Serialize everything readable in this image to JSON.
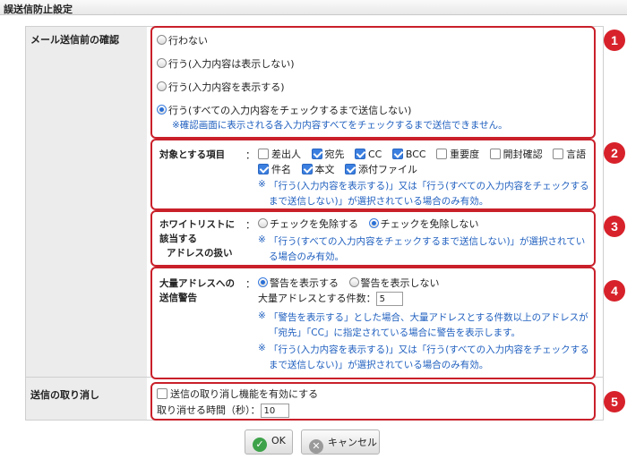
{
  "title": "誤送信防止設定",
  "rows": {
    "confirm_label": "メール送信前の確認",
    "cancel_label": "送信の取り消し"
  },
  "confirm": {
    "options": [
      "行わない",
      "行う(入力内容は表示しない)",
      "行う(入力内容を表示する)",
      "行う(すべての入力内容をチェックするまで送信しない)"
    ],
    "selected_index": 3,
    "note": "※確認画面に表示される各入力内容すべてをチェックするまで送信できません。"
  },
  "targets": {
    "label": "対象とする項目",
    "colon": "：",
    "items": [
      {
        "label": "差出人",
        "checked": false
      },
      {
        "label": "宛先",
        "checked": true
      },
      {
        "label": "CC",
        "checked": true
      },
      {
        "label": "BCC",
        "checked": true
      },
      {
        "label": "重要度",
        "checked": false
      },
      {
        "label": "開封確認",
        "checked": false
      },
      {
        "label": "言語",
        "checked": false
      },
      {
        "label": "件名",
        "checked": true
      },
      {
        "label": "本文",
        "checked": true
      },
      {
        "label": "添付ファイル",
        "checked": true
      }
    ],
    "note_mark": "※",
    "note_line1": "「行う(入力内容を表示する)」又は「行う(すべての入力内容をチェックする",
    "note_line2": "まで送信しない)」が選択されている場合のみ有効。"
  },
  "whitelist": {
    "label_line1": "ホワイトリストに",
    "label_line2": "該当する",
    "label_line3": "アドレスの扱い",
    "colon": "：",
    "options": [
      "チェックを免除する",
      "チェックを免除しない"
    ],
    "selected_index": 1,
    "note_mark": "※",
    "note_line1": "「行う(すべての入力内容をチェックするまで送信しない)」が選択されてい",
    "note_line2": "る場合のみ有効。"
  },
  "mass": {
    "label_line1": "大量アドレスへの",
    "label_line2": "送信警告",
    "colon": "：",
    "options": [
      "警告を表示する",
      "警告を表示しない"
    ],
    "selected_index": 0,
    "count_label": "大量アドレスとする件数：",
    "count_value": "5",
    "note_mark": "※",
    "note1_line1": "「警告を表示する」とした場合、大量アドレスとする件数以上のアドレスが",
    "note1_line2": "「宛先」「CC」に指定されている場合に警告を表示します。",
    "note2_line1": "「行う(入力内容を表示する)」又は「行う(すべての入力内容をチェックする",
    "note2_line2": "まで送信しない)」が選択されている場合のみ有効。"
  },
  "undo": {
    "checkbox_label": "送信の取り消し機能を有効にする",
    "checked": false,
    "time_label": "取り消せる時間（秒）：",
    "time_value": "10"
  },
  "markers": [
    "1",
    "2",
    "3",
    "4",
    "5"
  ],
  "buttons": {
    "ok": "OK",
    "cancel": "キャンセル"
  },
  "colors": {
    "highlight": "#c9202a",
    "note": "#1f5fbf",
    "ok_icon": "#3ea24a",
    "cancel_icon": "#9a9a9a"
  }
}
